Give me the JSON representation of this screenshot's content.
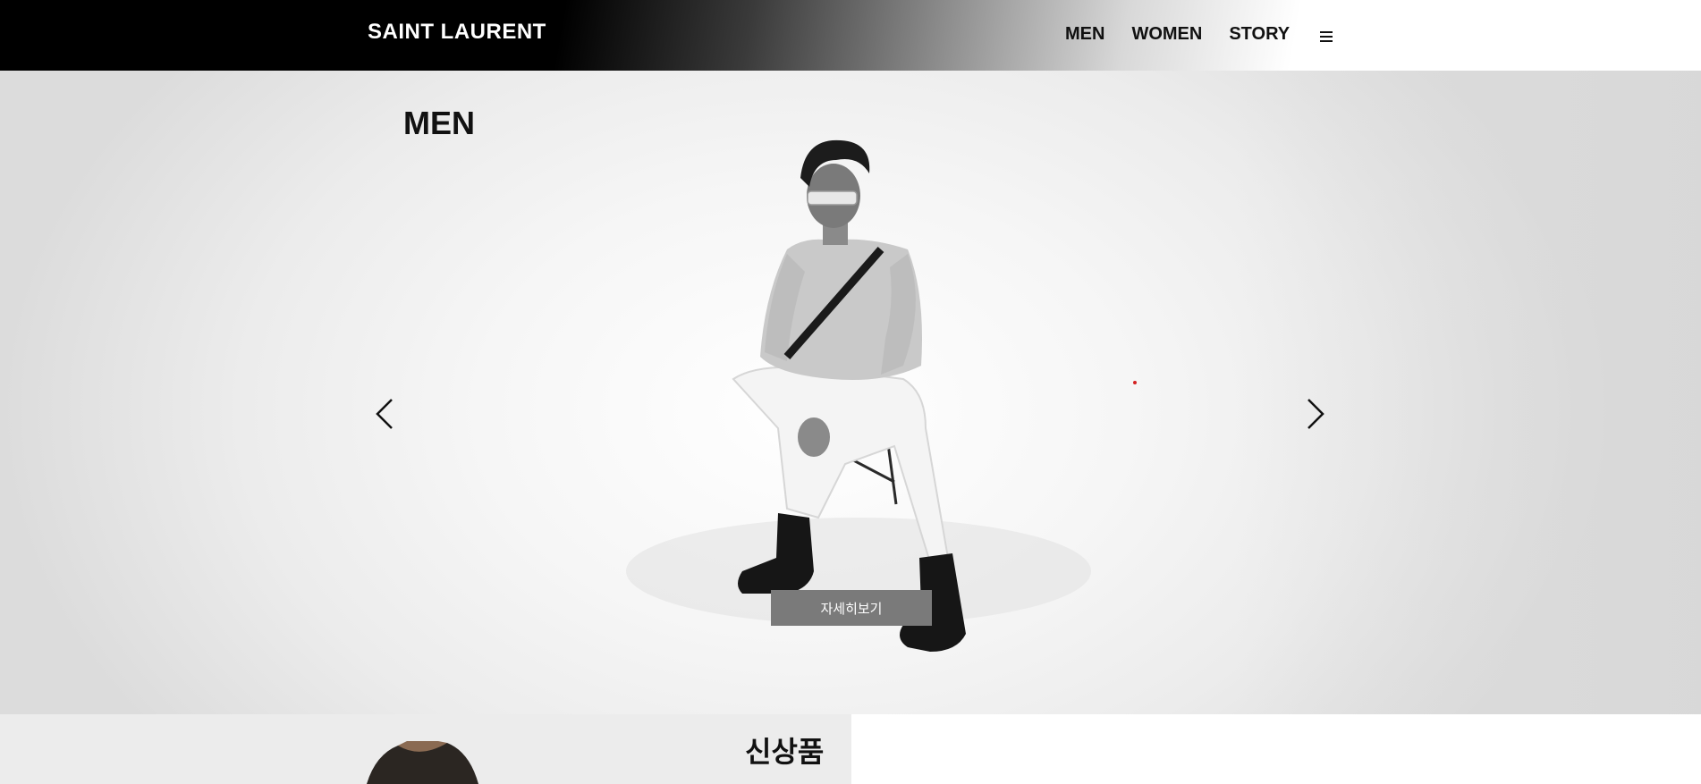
{
  "brand": {
    "logo": "SAINT LAURENT"
  },
  "nav": {
    "items": [
      "MEN",
      "WOMEN",
      "STORY"
    ],
    "menu_icon": "hamburger-icon"
  },
  "hero": {
    "title": "MEN",
    "more_button": "자세히보기",
    "prev_icon": "chevron-left-icon",
    "next_icon": "chevron-right-icon"
  },
  "new_section": {
    "title": "신상품"
  },
  "colors": {
    "header_dark": "#000000",
    "button_bg": "#7a7a7a",
    "indicator_dot": "#d31f1f"
  }
}
